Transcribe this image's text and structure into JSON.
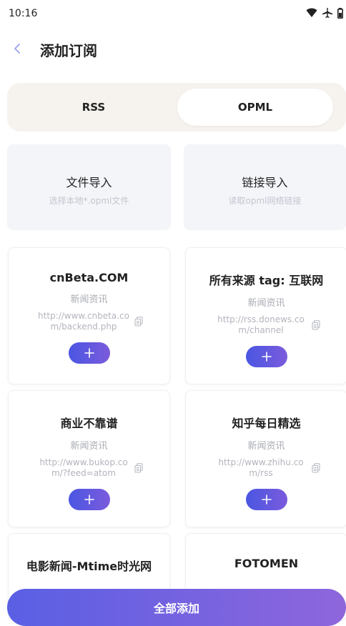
{
  "status_bar": {
    "time": "10:16",
    "icons": [
      "wifi-icon",
      "airplane-icon",
      "battery-icon"
    ]
  },
  "header": {
    "back_icon": "chevron-left-icon",
    "title": "添加订阅"
  },
  "tabs": [
    {
      "label": "RSS",
      "selected": false
    },
    {
      "label": "OPML",
      "selected": true
    }
  ],
  "import_options": [
    {
      "title": "文件导入",
      "subtitle": "选择本地*.opml文件"
    },
    {
      "title": "链接导入",
      "subtitle": "读取opml网络链接"
    }
  ],
  "feeds": [
    {
      "name": "cnBeta.COM",
      "category": "新闻资讯",
      "url": "http://www.cnbeta.com/backend.php"
    },
    {
      "name": "所有来源 tag: 互联网",
      "category": "新闻资讯",
      "url": "http://rss.donews.com/channel"
    },
    {
      "name": "商业不靠谱",
      "category": "新闻资讯",
      "url": "http://www.bukop.com/?feed=atom"
    },
    {
      "name": "知乎每日精选",
      "category": "新闻资讯",
      "url": "http://www.zhihu.com/rss"
    },
    {
      "name": "电影新闻-Mtime时光网",
      "category": "",
      "url": ""
    },
    {
      "name": "FOTOMEN",
      "category": "",
      "url": ""
    }
  ],
  "add_all_button": "全部添加",
  "colors": {
    "accent_start": "#4a56e2",
    "accent_end": "#8e66dc",
    "segment_bg": "#f6f2ee",
    "import_bg": "#f4f5f9",
    "muted_text": "#b3b5bd",
    "back_arrow": "#9aa0ee"
  }
}
